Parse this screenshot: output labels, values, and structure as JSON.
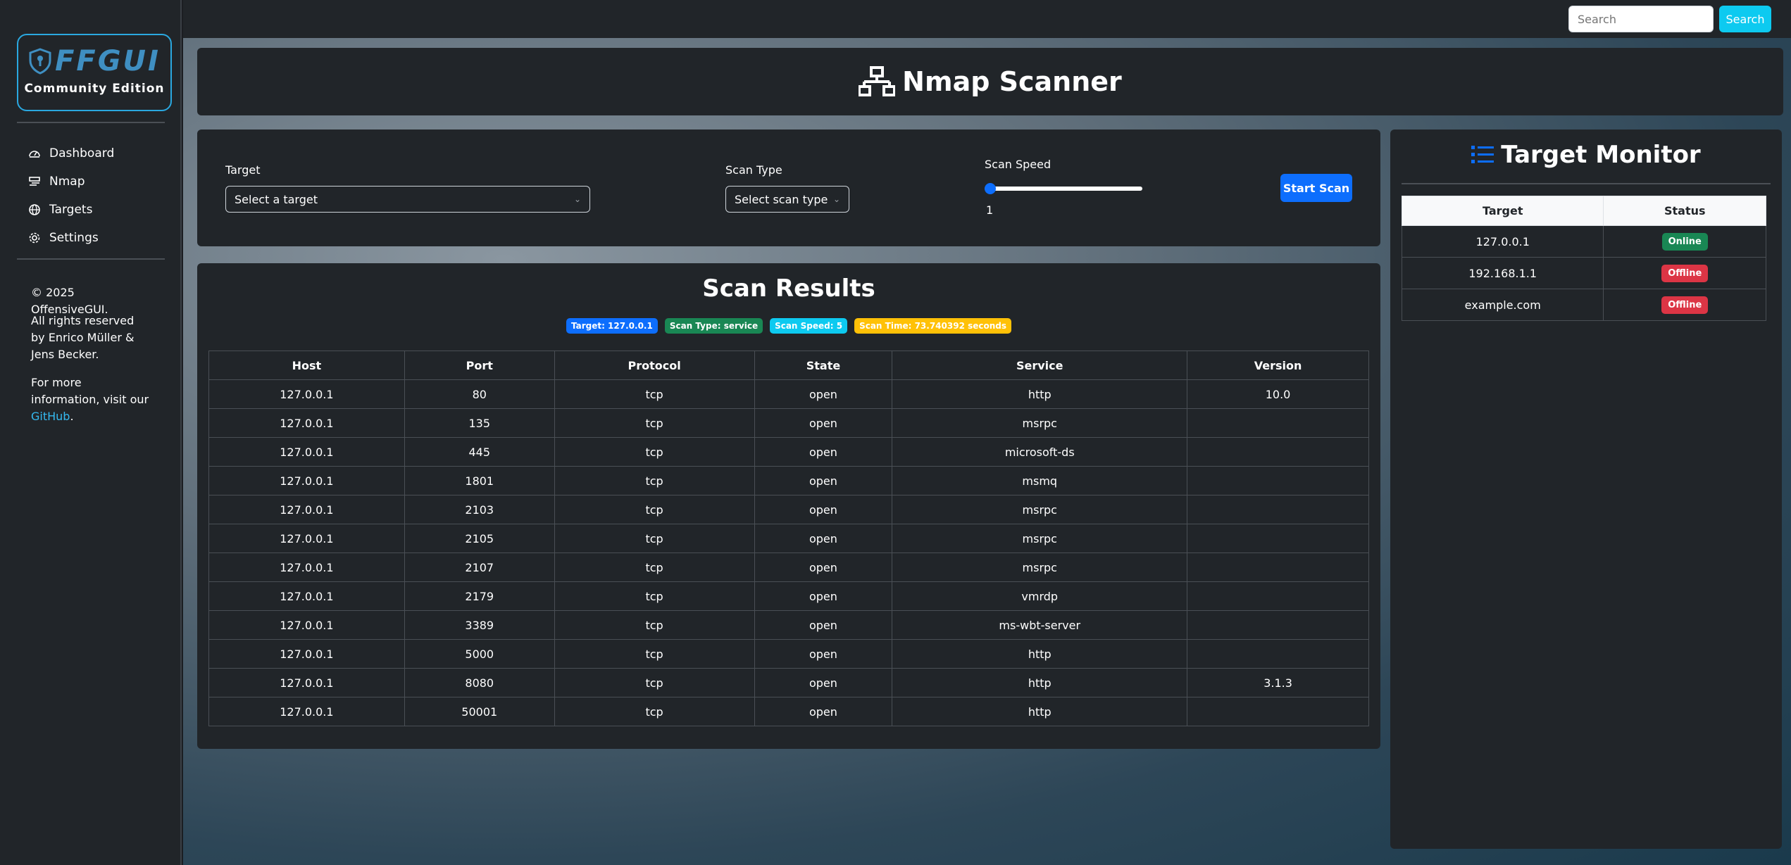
{
  "brand": {
    "name": "FFGUI",
    "edition": "Community Edition"
  },
  "sidebar": {
    "items": [
      {
        "label": "Dashboard",
        "icon": "speedometer-icon"
      },
      {
        "label": "Nmap",
        "icon": "nmap-icon"
      },
      {
        "label": "Targets",
        "icon": "globe-icon"
      },
      {
        "label": "Settings",
        "icon": "gear-icon"
      }
    ],
    "copyright": "© 2025 OffensiveGUI.",
    "rights": "All rights reserved by Enrico Müller & Jens Becker.",
    "info_prefix": "For more information, visit our",
    "info_link": "GitHub",
    "info_suffix": "."
  },
  "topbar": {
    "search_placeholder": "Search",
    "search_button": "Search"
  },
  "page": {
    "title": "Nmap Scanner"
  },
  "form": {
    "target_label": "Target",
    "target_value": "Select a target",
    "scan_type_label": "Scan Type",
    "scan_type_value": "Select scan type",
    "scan_speed_label": "Scan Speed",
    "scan_speed_value": "1",
    "start_button": "Start Scan"
  },
  "results": {
    "title": "Scan Results",
    "badges": [
      {
        "text": "Target: 127.0.0.1",
        "color": "#0d6efd"
      },
      {
        "text": "Scan Type: service",
        "color": "#198754"
      },
      {
        "text": "Scan Speed: 5",
        "color": "#0dcaf0"
      },
      {
        "text": "Scan Time: 73.740392 seconds",
        "color": "#ffc107"
      }
    ],
    "columns": [
      "Host",
      "Port",
      "Protocol",
      "State",
      "Service",
      "Version"
    ],
    "rows": [
      [
        "127.0.0.1",
        "80",
        "tcp",
        "open",
        "http",
        "10.0"
      ],
      [
        "127.0.0.1",
        "135",
        "tcp",
        "open",
        "msrpc",
        ""
      ],
      [
        "127.0.0.1",
        "445",
        "tcp",
        "open",
        "microsoft-ds",
        ""
      ],
      [
        "127.0.0.1",
        "1801",
        "tcp",
        "open",
        "msmq",
        ""
      ],
      [
        "127.0.0.1",
        "2103",
        "tcp",
        "open",
        "msrpc",
        ""
      ],
      [
        "127.0.0.1",
        "2105",
        "tcp",
        "open",
        "msrpc",
        ""
      ],
      [
        "127.0.0.1",
        "2107",
        "tcp",
        "open",
        "msrpc",
        ""
      ],
      [
        "127.0.0.1",
        "2179",
        "tcp",
        "open",
        "vmrdp",
        ""
      ],
      [
        "127.0.0.1",
        "3389",
        "tcp",
        "open",
        "ms-wbt-server",
        ""
      ],
      [
        "127.0.0.1",
        "5000",
        "tcp",
        "open",
        "http",
        ""
      ],
      [
        "127.0.0.1",
        "8080",
        "tcp",
        "open",
        "http",
        "3.1.3"
      ],
      [
        "127.0.0.1",
        "50001",
        "tcp",
        "open",
        "http",
        ""
      ]
    ]
  },
  "monitor": {
    "title": "Target Monitor",
    "columns": [
      "Target",
      "Status"
    ],
    "rows": [
      {
        "target": "127.0.0.1",
        "status": "Online",
        "color": "#198754"
      },
      {
        "target": "192.168.1.1",
        "status": "Offline",
        "color": "#dc3545"
      },
      {
        "target": "example.com",
        "status": "Offline",
        "color": "#dc3545"
      }
    ]
  }
}
